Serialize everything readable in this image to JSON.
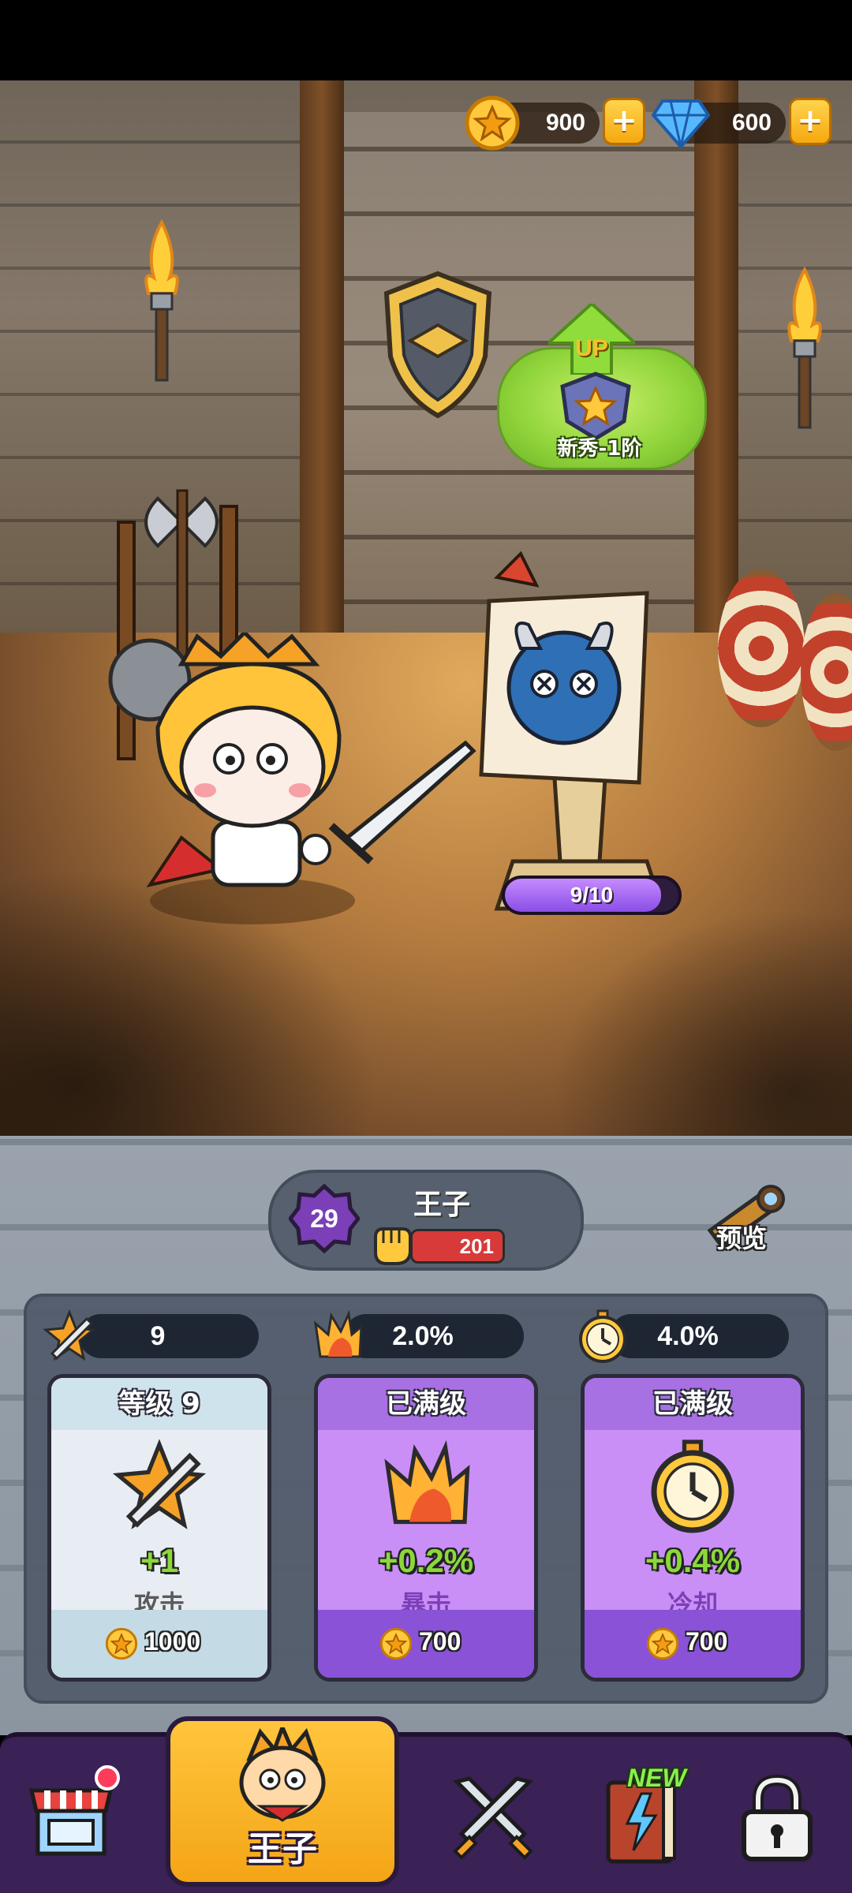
{
  "currency": {
    "gold": {
      "icon": "gold-star-coin-icon",
      "value": "900"
    },
    "gems": {
      "icon": "blue-diamond-icon",
      "value": "600"
    },
    "add_symbol": "+"
  },
  "rank": {
    "up_label": "UP",
    "name": "新秀-1阶"
  },
  "training_dummy": {
    "progress_text": "9/10",
    "progress_fraction": 0.9
  },
  "hero": {
    "level": "29",
    "name": "王子",
    "power": "201",
    "preview_label": "预览"
  },
  "stats": [
    {
      "icon": "sword-star-icon",
      "value": "9"
    },
    {
      "icon": "crit-flame-icon",
      "value": "2.0%"
    },
    {
      "icon": "stopwatch-icon",
      "value": "4.0%"
    }
  ],
  "upgrade_cards": [
    {
      "header": "等级 9",
      "bonus": "+1",
      "label": "攻击",
      "cost": "1000",
      "style": "white",
      "icon": "sword-star-icon"
    },
    {
      "header": "已满级",
      "bonus": "+0.2%",
      "label": "暴击",
      "cost": "700",
      "style": "purple",
      "icon": "crit-flame-icon"
    },
    {
      "header": "已满级",
      "bonus": "+0.4%",
      "label": "冷却",
      "cost": "700",
      "style": "purple",
      "icon": "stopwatch-icon"
    }
  ],
  "nav": {
    "items": [
      {
        "name": "shop",
        "icon": "shop-stall-icon"
      },
      {
        "name": "hero",
        "icon": "prince-face-icon",
        "label": "王子",
        "active": true
      },
      {
        "name": "battle",
        "icon": "crossed-swords-icon"
      },
      {
        "name": "book",
        "icon": "spellbook-icon",
        "badge": "NEW"
      },
      {
        "name": "locked",
        "icon": "padlock-icon"
      }
    ]
  },
  "colors": {
    "gold": "#f5a90f",
    "purple_accent": "#a770e3",
    "green_bonus": "#8bd83a",
    "power_red": "#d83a3a"
  }
}
